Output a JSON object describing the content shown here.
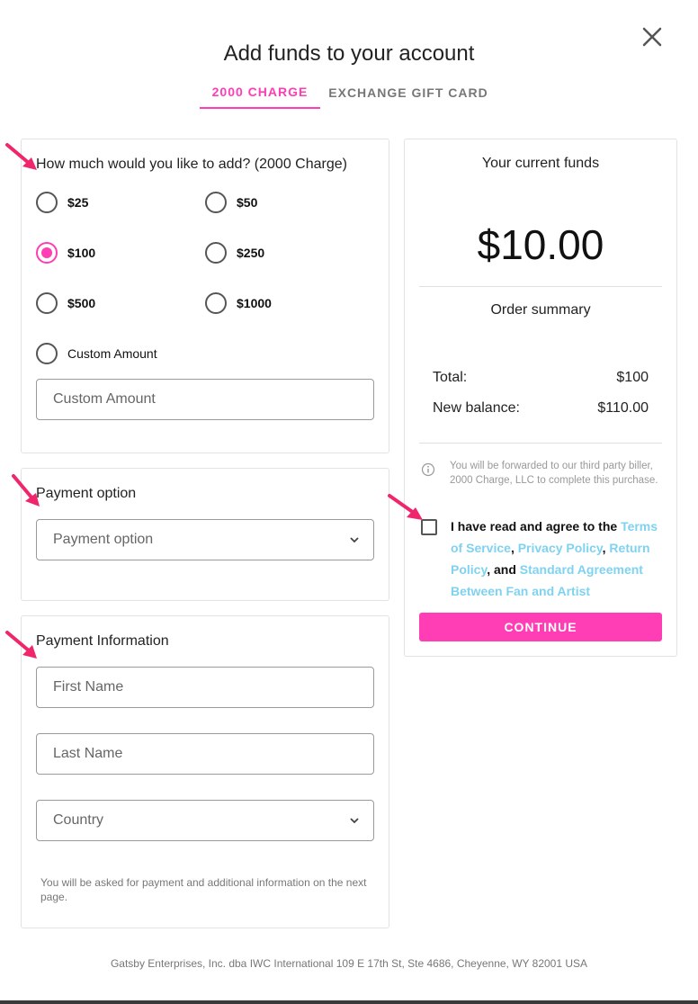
{
  "modal": {
    "title": "Add funds to your account",
    "tabs": [
      {
        "label": "2000 CHARGE",
        "active": true
      },
      {
        "label": "EXCHANGE GIFT CARD",
        "active": false
      }
    ]
  },
  "amount": {
    "heading": "How much would you like to add? (2000 Charge)",
    "options": [
      {
        "label": "$25",
        "selected": false
      },
      {
        "label": "$50",
        "selected": false
      },
      {
        "label": "$100",
        "selected": true
      },
      {
        "label": "$250",
        "selected": false
      },
      {
        "label": "$500",
        "selected": false
      },
      {
        "label": "$1000",
        "selected": false
      },
      {
        "label": "Custom Amount",
        "selected": false
      }
    ],
    "custom_placeholder": "Custom Amount"
  },
  "payment_option": {
    "heading": "Payment option",
    "placeholder": "Payment option"
  },
  "payment_info": {
    "heading": "Payment Information",
    "first_name_placeholder": "First Name",
    "last_name_placeholder": "Last Name",
    "country_placeholder": "Country",
    "note": "You will be asked for payment and additional information on the next page."
  },
  "summary": {
    "funds_label": "Your current funds",
    "funds_value": "$10.00",
    "order_label": "Order summary",
    "total_label": "Total:",
    "total_value": "$100",
    "balance_label": "New balance:",
    "balance_value": "$110.00",
    "info_text": "You will be forwarded to our third party biller, 2000 Charge, LLC to complete this purchase.",
    "agree_prefix": "I have read and agree to the",
    "terms_link": "Terms of Service",
    "privacy_link": "Privacy Policy",
    "return_link": "Return Policy",
    "and_text": ", and",
    "agreement_link": "Standard Agreement Between Fan and Artist",
    "continue_label": "CONTINUE"
  },
  "footer": {
    "text": "Gatsby Enterprises, Inc. dba IWC International 109 E 17th St, Ste 4686, Cheyenne, WY 82001 USA"
  },
  "colors": {
    "accent": "#ff3db4",
    "link": "#7fd2f0",
    "annotation_arrow": "#f0266c"
  },
  "icons": {
    "close": "close-icon",
    "chevron": "chevron-down-icon",
    "info": "info-icon"
  }
}
